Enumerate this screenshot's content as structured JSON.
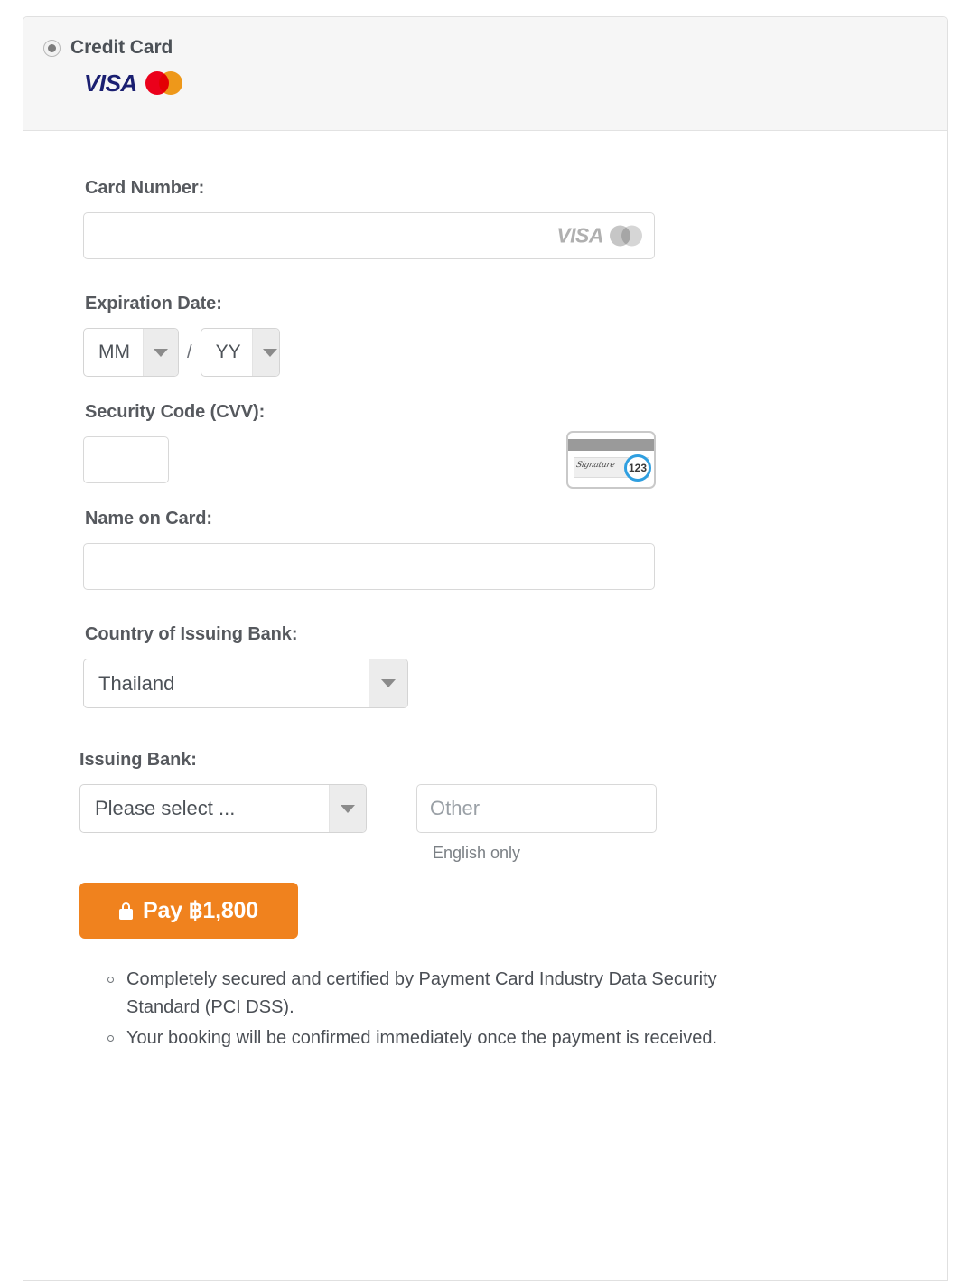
{
  "panel": {
    "method": {
      "label": "Credit Card",
      "selected": true,
      "brands": [
        "visa",
        "mastercard"
      ]
    },
    "card_number": {
      "label": "Card Number:",
      "value": "",
      "placeholder": "",
      "inline_brands": [
        "visa",
        "mastercard"
      ]
    },
    "expiration": {
      "label": "Expiration Date:",
      "month_value": "MM",
      "year_value": "YY",
      "separator": "/"
    },
    "security_code": {
      "label": "Security Code (CVV):",
      "value": "",
      "placeholder": "",
      "helper_card": {
        "signature_text": "Signature",
        "cvv_digits": "123"
      }
    },
    "name_on_card": {
      "label": "Name on Card:",
      "value": "",
      "placeholder": ""
    },
    "country": {
      "label": "Country of Issuing Bank:",
      "value": "Thailand"
    },
    "issuing_bank": {
      "label": "Issuing Bank:",
      "select_value": "Please select ...",
      "other_value": "",
      "other_placeholder": "Other",
      "help_note": "English only"
    },
    "pay_button": {
      "label": "Pay ฿1,800",
      "icon": "lock-icon",
      "color": "#f0821e"
    },
    "notes": [
      "Completely secured and certified by Payment Card Industry Data Security Standard (PCI DSS).",
      "Your booking will be confirmed immediately once the payment is received."
    ]
  },
  "colors": {
    "visa_blue": "#1a1f71",
    "mastercard_red": "#eb001b",
    "mastercard_yellow": "#f79e1b",
    "pay_orange": "#f0821e",
    "cvv_highlight": "#2f9fe0"
  }
}
